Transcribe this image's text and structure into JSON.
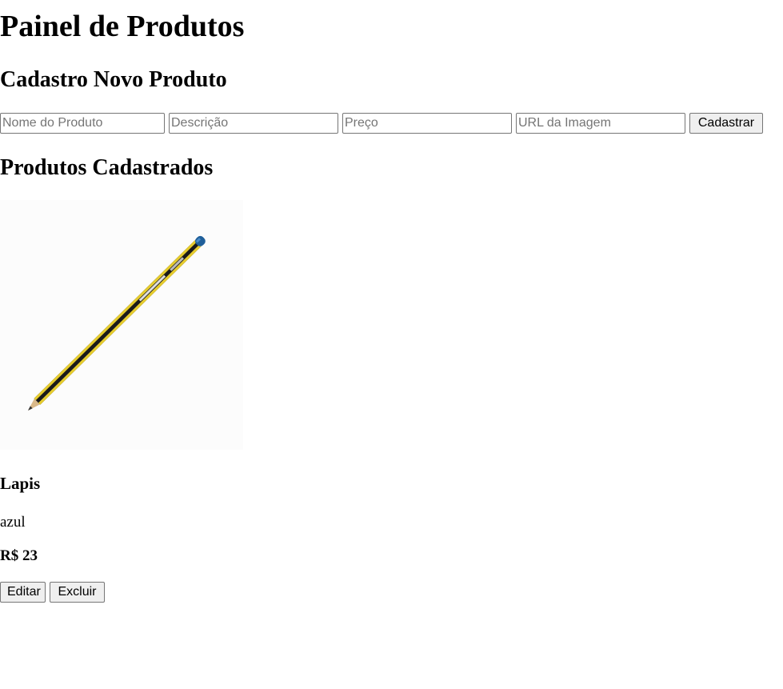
{
  "page_title": "Painel de Produtos",
  "form": {
    "heading": "Cadastro Novo Produto",
    "name_placeholder": "Nome do Produto",
    "name_value": "",
    "description_placeholder": "Descrição",
    "description_value": "",
    "price_placeholder": "Preço",
    "price_value": "",
    "image_url_placeholder": "URL da Imagem",
    "image_url_value": "",
    "submit_label": "Cadastrar"
  },
  "products_section": {
    "heading": "Produtos Cadastrados",
    "products": [
      {
        "image": "pencil-image",
        "name": "Lapis",
        "description": "azul",
        "price": "R$ 23",
        "edit_label": "Editar",
        "delete_label": "Excluir"
      }
    ]
  }
}
